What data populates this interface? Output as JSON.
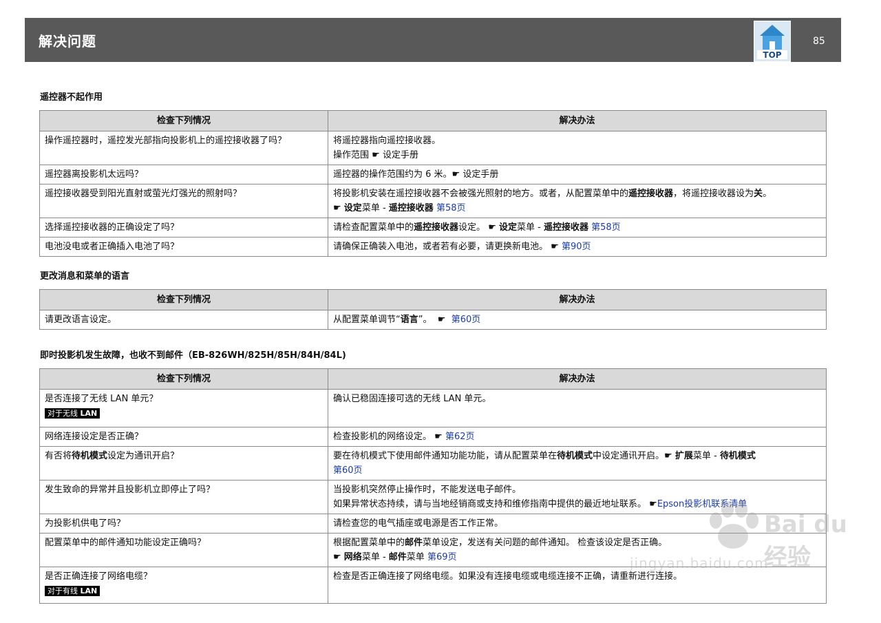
{
  "header": {
    "title": "解决问题",
    "top_label": "TOP",
    "page_number": "85"
  },
  "colors": {
    "header_bg": "#595959",
    "table_header_bg": "#d9d9d9",
    "link": "#1a3ba8",
    "badge_bg": "#000000"
  },
  "sections": [
    {
      "title": "遥控器不起作用",
      "col_check": "检查下列情况",
      "col_solution": "解决办法",
      "rows": [
        {
          "check": "操作遥控器时，遥控发光部指向投影机上的遥控接收器了吗？",
          "s_line1": "将遥控器指向遥控接收器。",
          "s_line2_text": "操作范围",
          "s_line2_ref": "设定手册"
        },
        {
          "check": "遥控器离投影机太远吗？",
          "s_text": "遥控器的操作范围约为 6 米。",
          "s_ref": "设定手册"
        },
        {
          "check": "遥控接收器受到阳光直射或萤光灯强光的照射吗？",
          "s_t1": "将投影机安装在遥控接收器不会被强光照射的地方。或者，从配置菜单中的",
          "s_b1": "遥控接收器",
          "s_t2": "，将遥控接收器设为",
          "s_b2": "关",
          "s_t3": "。",
          "s_ref_menu": "设定",
          "s_ref_menu_suffix": "菜单 - ",
          "s_ref_item": "遥控接收器",
          "s_ref_page": "第58页"
        },
        {
          "check": "选择遥控接收器的正确设定了吗？",
          "s_t1": "请检查配置菜单中的",
          "s_b1": "遥控接收器",
          "s_t2": "设定。",
          "s_ref_menu": "设定",
          "s_ref_menu_suffix": "菜单 - ",
          "s_ref_item": "遥控接收器",
          "s_ref_page": "第58页"
        },
        {
          "check": "电池没电或者正确插入电池了吗？",
          "s_text": "请确保正确装入电池，或者若有必要，请更换新电池。",
          "s_ref_page": "第90页"
        }
      ]
    },
    {
      "title": "更改消息和菜单的语言",
      "col_check": "检查下列情况",
      "col_solution": "解决办法",
      "rows": [
        {
          "check": "请更改语言设定。",
          "s_t1": "从配置菜单调节“",
          "s_b1": "语言",
          "s_t2": "”。",
          "s_ref_page": "第60页"
        }
      ]
    },
    {
      "title": "即时投影机发生故障，也收不到邮件（EB-826WH/825H/85H/84H/84L)",
      "col_check": "检查下列情况",
      "col_solution": "解决办法",
      "rows": [
        {
          "check": "是否连接了无线 LAN 单元？",
          "badge_t": "对于无线 ",
          "badge_b": "LAN",
          "s_text": "确认已稳固连接可选的无线 LAN 单元。"
        },
        {
          "check": "网络连接设定是否正确？",
          "s_text": "检查投影机的网络设定。",
          "s_ref_page": "第62页"
        },
        {
          "check_t1": "有否将",
          "check_b1": "待机模式",
          "check_t2": "设定为通讯开启？",
          "s_t1": "要在待机模式下使用邮件通知功能功能，请从配置菜单在",
          "s_b1": "待机模式",
          "s_t2": "中设定通讯开启。",
          "s_ref_menu": "扩展",
          "s_ref_menu_suffix": "菜单 - ",
          "s_ref_item": "待机模式",
          "s_ref_page": "第60页"
        },
        {
          "check": "发生致命的异常并且投影机立即停止了吗？",
          "s_line1": "当投影机突然停止操作时，不能发送电子邮件。",
          "s_line2_text": "如果异常状态持续，请与当地经销商或支持和维修指南中提供的最近地址联系。",
          "s_line2_ref": "Epson投影机联系清单"
        },
        {
          "check": "为投影机供电了吗？",
          "s_text": "请检查您的电气插座或电源是否工作正常。"
        },
        {
          "check": "配置菜单中的邮件通知功能设定正确吗？",
          "s_t1": "根据配置菜单中的",
          "s_b1": "邮件",
          "s_t2": "菜单设定，发送有关问题的邮件通知。 检查该设定是否正确。",
          "s_ref_menu": "网络",
          "s_ref_menu_suffix": "菜单 - ",
          "s_ref_item": "邮件",
          "s_ref_item_suffix": "菜单",
          "s_ref_page": "第69页"
        },
        {
          "check": "是否正确连接了网络电缆？",
          "badge_t": "对于有线 ",
          "badge_b": "LAN",
          "s_text": "检查是否正确连接了网络电缆。如果没有连接电缆或电缆连接不正确，请重新进行连接。"
        }
      ]
    }
  ],
  "ref_icon": "pointing-hand-icon",
  "watermark": {
    "brand": "Bai du 经验",
    "url": "jingyan.baidu.com"
  }
}
